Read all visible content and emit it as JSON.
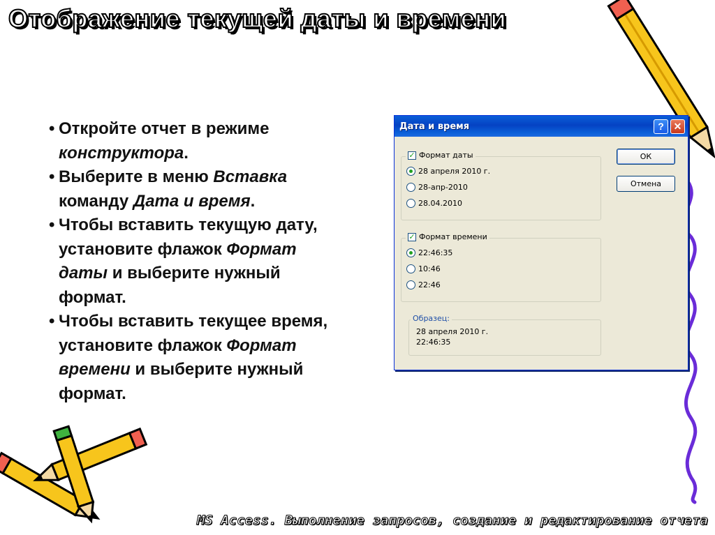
{
  "slide": {
    "title": "Отображение текущей даты и времени",
    "footer": "MS Access. Выполнение запросов, создание и редактирование отчета",
    "bullets": [
      {
        "parts": [
          {
            "t": "Откройте отчет в режиме "
          },
          {
            "t": "конструктора",
            "i": true
          },
          {
            "t": "."
          }
        ]
      },
      {
        "parts": [
          {
            "t": "Выберите в меню "
          },
          {
            "t": "Вставка",
            "i": true
          },
          {
            "t": " команду "
          },
          {
            "t": "Дата и время",
            "i": true
          },
          {
            "t": "."
          }
        ]
      },
      {
        "parts": [
          {
            "t": "Чтобы вставить текущую дату, установите флажок "
          },
          {
            "t": "Формат даты",
            "i": true
          },
          {
            "t": " и выберите нужный формат."
          }
        ]
      },
      {
        "parts": [
          {
            "t": "Чтобы вставить текущее время, установите флажок "
          },
          {
            "t": "Формат времени",
            "i": true
          },
          {
            "t": " и выберите нужный формат."
          }
        ]
      }
    ]
  },
  "dialog": {
    "title": "Дата и время",
    "help_label": "?",
    "close_label": "✕",
    "date_group": {
      "label": "Формат даты",
      "checked": true,
      "options": [
        "28 апреля 2010 г.",
        "28-апр-2010",
        "28.04.2010"
      ],
      "selected": 0
    },
    "time_group": {
      "label": "Формат времени",
      "checked": true,
      "options": [
        "22:46:35",
        "10:46",
        "22:46"
      ],
      "selected": 0
    },
    "sample": {
      "label": "Образец:",
      "line1": "28 апреля 2010 г.",
      "line2": "22:46:35"
    },
    "ok_label": "ОК",
    "cancel_label": "Отмена"
  },
  "colors": {
    "titlebar": "#0a5fd8",
    "dialog_bg": "#ece9d8",
    "check_green": "#21a121"
  }
}
